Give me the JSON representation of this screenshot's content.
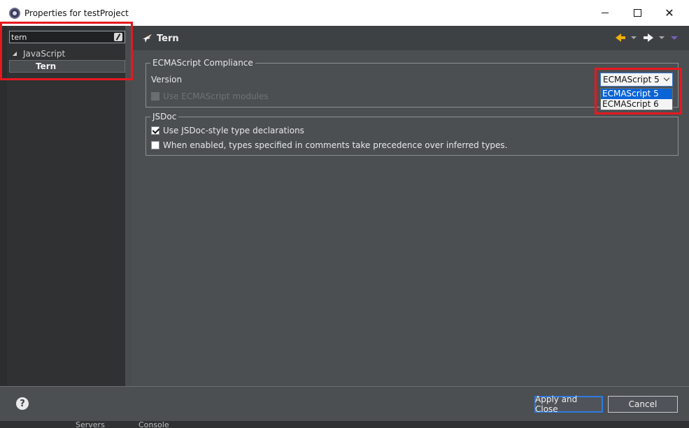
{
  "window": {
    "title": "Properties for testProject",
    "icon": "eclipse-icon",
    "controls": [
      "minimize-icon",
      "maximize-icon",
      "close-icon"
    ],
    "close_glyph": "✕"
  },
  "sidebar": {
    "filter_value": "tern",
    "tree": [
      {
        "label": "JavaScript",
        "expanded": true,
        "expander_glyph": "◢"
      },
      {
        "label": "Tern",
        "selected": true
      }
    ]
  },
  "page": {
    "title": "Tern",
    "title_icon": "tern-bird-icon",
    "nav_icons": [
      "back-arrow-icon",
      "back-menu-icon",
      "forward-arrow-icon",
      "forward-menu-icon",
      "view-menu-icon"
    ]
  },
  "ecma_group": {
    "legend": "ECMAScript Compliance",
    "version_label": "Version",
    "version_selected": "ECMAScript 5",
    "version_options": [
      "ECMAScript 5",
      "ECMAScript 6"
    ],
    "highlighted_option_index": 0,
    "modules_label": "Use ECMAScript modules",
    "modules_checked": false,
    "modules_enabled": false
  },
  "jsdoc_group": {
    "legend": "JSDoc",
    "option1_label": "Use JSDoc-style type declarations",
    "option1_checked": true,
    "option2_label": "When enabled, types specified in comments take precedence over inferred types.",
    "option2_checked": false
  },
  "footer": {
    "help_glyph": "?",
    "apply_label": "Apply and Close",
    "cancel_label": "Cancel"
  },
  "background_window": {
    "tabs": [
      "Servers",
      "Console"
    ]
  },
  "colors": {
    "highlight": "#e8181f",
    "selection": "#0a64d6",
    "nav_back": "#f0b000",
    "panel": "#4b4f52"
  }
}
